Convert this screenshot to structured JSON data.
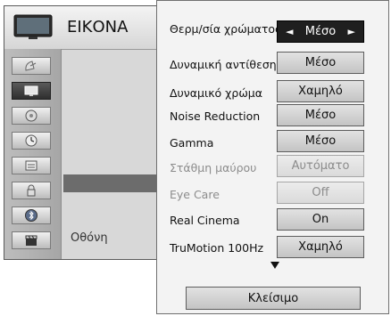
{
  "menu": {
    "title": "ΕΙΚΟΝΑ",
    "screen_label": "Οθόνη",
    "side_icons": [
      {
        "name": "satellite-dish-icon"
      },
      {
        "name": "tv-screen-icon",
        "active": true
      },
      {
        "name": "disc-icon"
      },
      {
        "name": "clock-icon"
      },
      {
        "name": "option-box-icon"
      },
      {
        "name": "lock-icon"
      },
      {
        "name": "bluetooth-icon"
      },
      {
        "name": "clapperboard-icon"
      }
    ]
  },
  "submenu": {
    "rows": [
      {
        "label": "Θερμ/σία χρώματος",
        "value": "Μέσο",
        "selected": true,
        "left_arrow": "◄",
        "right_arrow": "►"
      },
      {
        "label": "Δυναμική αντίθεση",
        "value": "Μέσο"
      },
      {
        "label": "Δυναμικό χρώμα",
        "value": "Χαμηλό"
      },
      {
        "label": "Noise Reduction",
        "value": "Μέσο"
      },
      {
        "label": "Gamma",
        "value": "Μέσο"
      },
      {
        "label": "Στάθμη μαύρου",
        "value": "Αυτόματο",
        "disabled": true
      },
      {
        "label": "Eye Care",
        "value": "Off",
        "disabled": true
      },
      {
        "label": "Real Cinema",
        "value": "On"
      },
      {
        "label": "TruMotion 100Hz",
        "value": "Χαμηλό"
      }
    ],
    "close_label": "Κλείσιμο"
  }
}
